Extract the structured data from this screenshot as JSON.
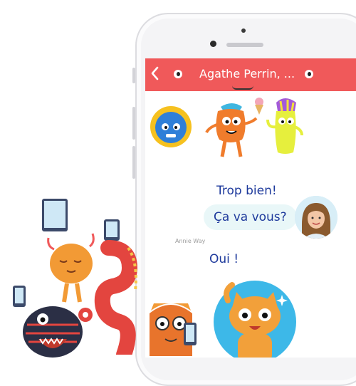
{
  "chat": {
    "title": "Agathe Perrin, ...",
    "back_icon": "chevron-left-icon",
    "header_color": "#f0595a"
  },
  "messages": [
    {
      "text": "Trop bien!",
      "align": "right"
    },
    {
      "text": "Ça va vous?",
      "align": "right",
      "bubble": true
    },
    {
      "sender": "Annie Way"
    },
    {
      "text": "Oui !",
      "align": "left"
    }
  ],
  "colors": {
    "text": "#1e3a9c",
    "bubble": "#e9f7f8"
  }
}
